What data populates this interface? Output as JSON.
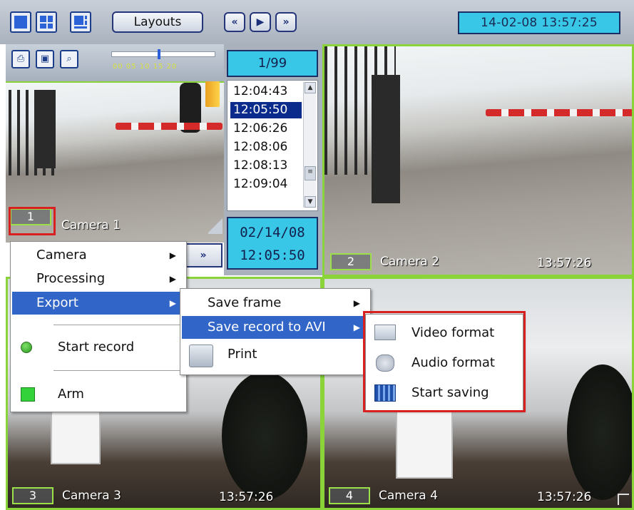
{
  "toolbar": {
    "layouts_label": "Layouts",
    "nav_prev": "«",
    "nav_play": "▶",
    "nav_next": "»",
    "clock": "14-02-08   13:57:25"
  },
  "panel": {
    "counter": "1/99",
    "times": [
      "12:04:43",
      "12:05:50",
      "12:06:26",
      "12:08:06",
      "12:08:13",
      "12:09:04"
    ],
    "selected_index": 1,
    "scale_labels": "00 05 10 15 20",
    "date": "02/14/08",
    "time": "12:05:50",
    "forward": "»"
  },
  "cameras": [
    {
      "num": "1",
      "name": "Camera 1",
      "time": ""
    },
    {
      "num": "2",
      "name": "Camera 2",
      "time": "13:57:26"
    },
    {
      "num": "3",
      "name": "Camera 3",
      "time": "13:57:26"
    },
    {
      "num": "4",
      "name": "Camera 4",
      "time": "13:57:26"
    }
  ],
  "menu_main": {
    "items": [
      "Camera",
      "Processing",
      "Export",
      "Start record",
      "Arm"
    ]
  },
  "menu_export": {
    "items": [
      "Save frame",
      "Save record to AVI",
      "Print"
    ]
  },
  "menu_avi": {
    "items": [
      "Video format",
      "Audio format",
      "Start saving"
    ]
  },
  "icons": {
    "start_record": "green-circle-icon",
    "arm": "green-square-icon"
  },
  "colors": {
    "accent_cyan": "#38c7e6",
    "highlight": "#3166c8",
    "frame_green": "#8ad43a",
    "red_frame": "#d92020"
  }
}
